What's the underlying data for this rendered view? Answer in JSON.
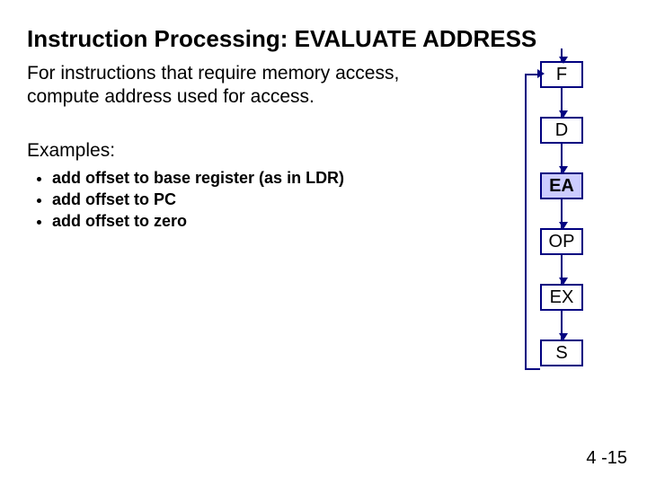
{
  "title": "Instruction Processing: EVALUATE ADDRESS",
  "lead": "For instructions that require memory access, compute address used for access.",
  "examples_heading": "Examples:",
  "examples": {
    "0": "add offset to base register (as in LDR)",
    "1": "add offset to PC",
    "2": "add offset to zero"
  },
  "stages": {
    "F": "F",
    "D": "D",
    "EA": "EA",
    "OP": "OP",
    "EX": "EX",
    "S": "S"
  },
  "pagenum": "4 -15"
}
